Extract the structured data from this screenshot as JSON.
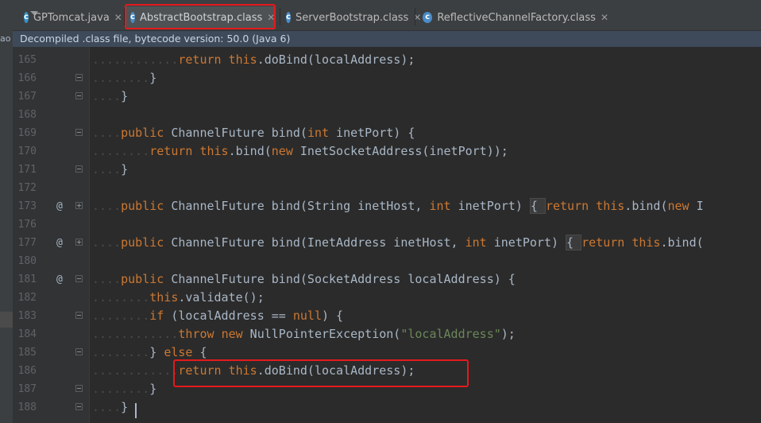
{
  "project_strip_text": "ao",
  "tabs": [
    {
      "label": "GPTomcat.java",
      "icon": "java-class-icon",
      "close": "✕"
    },
    {
      "label": "AbstractBootstrap.class",
      "icon": "class-file-icon",
      "close": "✕"
    },
    {
      "label": "ServerBootstrap.class",
      "icon": "class-file-icon",
      "close": "✕"
    },
    {
      "label": "ReflectiveChannelFactory.class",
      "icon": "class-file-icon",
      "close": "✕"
    }
  ],
  "banner": "Decompiled .class file, bytecode version: 50.0 (Java 6)",
  "lines": [
    {
      "num": "165",
      "anno": "",
      "fold": ""
    },
    {
      "num": "166",
      "anno": "",
      "fold": "minus"
    },
    {
      "num": "167",
      "anno": "",
      "fold": "minus"
    },
    {
      "num": "168",
      "anno": "",
      "fold": ""
    },
    {
      "num": "169",
      "anno": "",
      "fold": "minus"
    },
    {
      "num": "170",
      "anno": "",
      "fold": ""
    },
    {
      "num": "171",
      "anno": "",
      "fold": "minus"
    },
    {
      "num": "172",
      "anno": "",
      "fold": ""
    },
    {
      "num": "173",
      "anno": "@",
      "fold": "plus"
    },
    {
      "num": "176",
      "anno": "",
      "fold": ""
    },
    {
      "num": "177",
      "anno": "@",
      "fold": "plus"
    },
    {
      "num": "180",
      "anno": "",
      "fold": ""
    },
    {
      "num": "181",
      "anno": "@",
      "fold": "minus"
    },
    {
      "num": "182",
      "anno": "",
      "fold": ""
    },
    {
      "num": "183",
      "anno": "",
      "fold": "minus"
    },
    {
      "num": "184",
      "anno": "",
      "fold": ""
    },
    {
      "num": "185",
      "anno": "",
      "fold": "minus"
    },
    {
      "num": "186",
      "anno": "",
      "fold": ""
    },
    {
      "num": "187",
      "anno": "",
      "fold": "minus"
    },
    {
      "num": "188",
      "anno": "",
      "fold": "minus"
    }
  ],
  "code": {
    "l165": {
      "ind": "............",
      "kw1": "return",
      "sp1": " ",
      "kw2": "this",
      "rest": ".doBind(localAddress);"
    },
    "l166": {
      "ind": "........",
      "rest": "}"
    },
    "l167": {
      "ind": "....",
      "rest": "}"
    },
    "l169": {
      "ind": "....",
      "kw1": "public",
      "rest": " ChannelFuture bind(",
      "kw2": "int",
      "rest2": " inetPort) {"
    },
    "l170": {
      "ind": "........",
      "kw1": "return",
      "sp1": " ",
      "kw2": "this",
      "rest": ".bind(",
      "kw3": "new",
      "rest2": " InetSocketAddress(inetPort));"
    },
    "l171": {
      "ind": "....",
      "rest": "}"
    },
    "l173": {
      "ind": "....",
      "kw1": "public",
      "rest": " ChannelFuture bind(String inetHost, ",
      "kw2": "int",
      "rest2": " inetPort) ",
      "brace": "{ ",
      "kw3": "return",
      "sp": " ",
      "kw4": "this",
      "rest3": ".bind(",
      "kw5": "new",
      "rest4": " I"
    },
    "l177": {
      "ind": "....",
      "kw1": "public",
      "rest": " ChannelFuture bind(InetAddress inetHost, ",
      "kw2": "int",
      "rest2": " inetPort) ",
      "brace": "{ ",
      "kw3": "return",
      "sp": " ",
      "kw4": "this",
      "rest3": ".bind("
    },
    "l181": {
      "ind": "....",
      "kw1": "public",
      "rest": " ChannelFuture bind(SocketAddress localAddress) {"
    },
    "l182": {
      "ind": "........",
      "kw1": "this",
      "rest": ".validate();"
    },
    "l183": {
      "ind": "........",
      "kw1": "if",
      "rest": " (localAddress == ",
      "kw2": "null",
      "rest2": ") {"
    },
    "l184": {
      "ind": "............",
      "kw1": "throw",
      "sp1": " ",
      "kw2": "new",
      "rest": " NullPointerException(",
      "str": "\"localAddress\"",
      "rest2": ");"
    },
    "l185": {
      "ind": "........",
      "rest": "} ",
      "kw1": "else",
      "rest2": " {"
    },
    "l186": {
      "ind": "............",
      "kw1": "return",
      "sp1": " ",
      "kw2": "this",
      "rest": ".doBind(localAddress);"
    },
    "l187": {
      "ind": "........",
      "rest": "}"
    },
    "l188": {
      "ind": "....",
      "rest": "}"
    }
  }
}
